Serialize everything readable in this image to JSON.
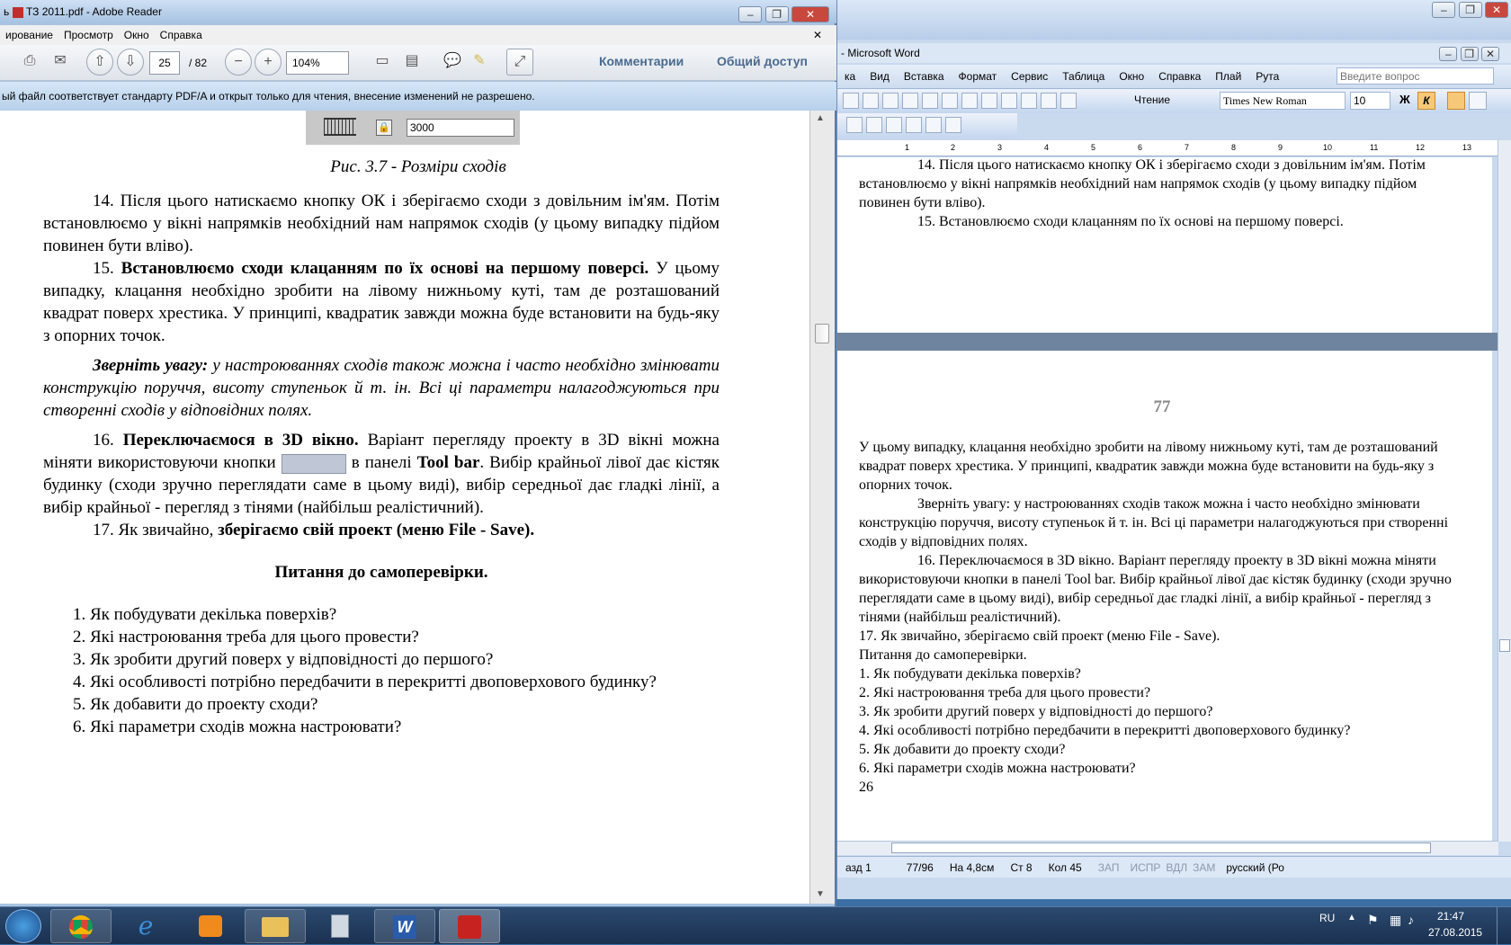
{
  "word": {
    "title": "- Microsoft Word",
    "menu": [
      "ка",
      "Вид",
      "Вставка",
      "Формат",
      "Сервис",
      "Таблица",
      "Окно",
      "Справка",
      "Плай",
      "Рута"
    ],
    "search_placeholder": "Введите вопрос",
    "read_label": "Чтение",
    "font_name": "Times New Roman",
    "font_size": "10",
    "bold_label": "Ж",
    "italic_label": "К",
    "ruler_labels": [
      "1",
      "2",
      "3",
      "4",
      "5",
      "6",
      "7",
      "8",
      "9",
      "10",
      "11",
      "12",
      "13"
    ],
    "page1": {
      "p1": "14. Після цього натискаємо кнопку ОК і зберігаємо сходи з довільним ім'ям. Потім встановлюємо у вікні напрямків необхідний нам напрямок сходів (у цьому випадку підйом повинен бути вліво).",
      "p2": "15. Встановлюємо сходи клацанням по їх основі на першому поверсі."
    },
    "page2": {
      "number": "77",
      "p1": "У цьому випадку, клацання необхідно зробити на лівому нижньому куті, там де розташований квадрат поверх хрестика. У принципі, квадратик завжди можна буде встановити на будь-яку з опорних точок.",
      "p2": "Зверніть увагу: у настроюваннях сходів також можна і часто необхідно змінювати конструкцію поруччя, висоту ступеньок й т. ін. Всі ці параметри налагоджуються при створенні сходів у відповідних полях.",
      "p3": "16. Переключаємося в 3D вікно. Варіант перегляду проекту в 3D вікні можна міняти використовуючи кнопки в панелі Tool bar. Вибір крайньої лівої дає кістяк будинку (сходи зручно переглядати саме в цьому виді), вибір середньої дає гладкі лінії, а вибір крайньої - перегляд з тінями (найбільш реалістичний).",
      "p4": "17. Як звичайно, зберігаємо свій проект (меню File - Save).",
      "p5": "Питання до самоперевірки.",
      "q": [
        "1. Як побудувати декілька поверхів?",
        "2. Які настроювання треба для цього провести?",
        "3. Як зробити другий поверх у відповідності до першого?",
        "4. Які особливості потрібно передбачити в перекритті двоповерхового будинку?",
        "5. Як добавити до проекту сходи?",
        "6. Які параметри сходів можна настроювати?"
      ],
      "last": "26"
    },
    "status": {
      "razd": "азд 1",
      "pages": "77/96",
      "pos": "На 4,8см",
      "line": "Ст 8",
      "col": "Кол 45",
      "zap": "ЗАП",
      "ispr": "ИСПР",
      "vdl": "ВДЛ",
      "zam": "ЗАМ",
      "lang": "русский (Ро"
    }
  },
  "acro": {
    "title": "ТЗ 2011.pdf - Adobe Reader",
    "title_prefix": "ь",
    "menu": [
      "ирование",
      "Просмотр",
      "Окно",
      "Справка"
    ],
    "page_current": "25",
    "page_total": "/ 82",
    "zoom": "104%",
    "comments": "Комментарии",
    "share": "Общий доступ",
    "banner": "ый файл соответствует стандарту PDF/A и открыт только для чтения, внесение изменений не разрешено.",
    "figure_field": "3000",
    "caption": "Рис. 3.7 - Розміри сходів",
    "p14": "14. Після цього натискаємо кнопку ОК і зберігаємо сходи з довільним ім'ям. Потім встановлюємо у вікні напрямків необхідний нам напрямок сходів (у цьому випадку підйом повинен бути вліво).",
    "p15_num": "15. ",
    "p15_bold": "Встановлюємо сходи клацанням по їх основі на першому поверсі.",
    "p15_rest": " У цьому випадку, клацання необхідно зробити на лівому нижньому куті, там де розташований квадрат поверх хрестика. У принципі, квадратик завжди можна буде встановити на будь-яку з опорних точок.",
    "note_bold": "Зверніть увагу:",
    "note_rest": " у настроюваннях сходів також можна і часто необхідно змінювати конструкцію поруччя, висоту ступеньок й т. ін. Всі ці параметри налагоджуються при створенні сходів у відповідних полях.",
    "p16_num": "16. ",
    "p16_bold": "Переключаємося в 3D вікно.",
    "p16_a": " Варіант перегляду проекту в 3D вікні можна міняти використовуючи кнопки",
    "p16_b": " в панелі ",
    "p16_toolbar": "Tool bar",
    "p16_c": ". Вибір крайньої лівої дає кістяк будинку (сходи зручно переглядати саме в цьому виді), вибір середньої дає гладкі лінії, а вибір крайньої - перегляд з тінями (найбільш реалістичний).",
    "p17_a": "17. Як звичайно, ",
    "p17_bold": "зберігаємо свій проект (меню File - Save).",
    "heading": "Питання до самоперевірки.",
    "questions": [
      "Як побудувати декілька поверхів?",
      "Які настроювання треба для цього провести?",
      "Як зробити другий поверх у відповідності до першого?",
      "Які особливості потрібно передбачити в перекритті двоповерхового будинку?",
      "Як добавити до проекту сходи?",
      "Які параметри сходів можна настроювати?"
    ]
  },
  "taskbar": {
    "lang": "RU",
    "time": "21:47",
    "date": "27.08.2015"
  }
}
